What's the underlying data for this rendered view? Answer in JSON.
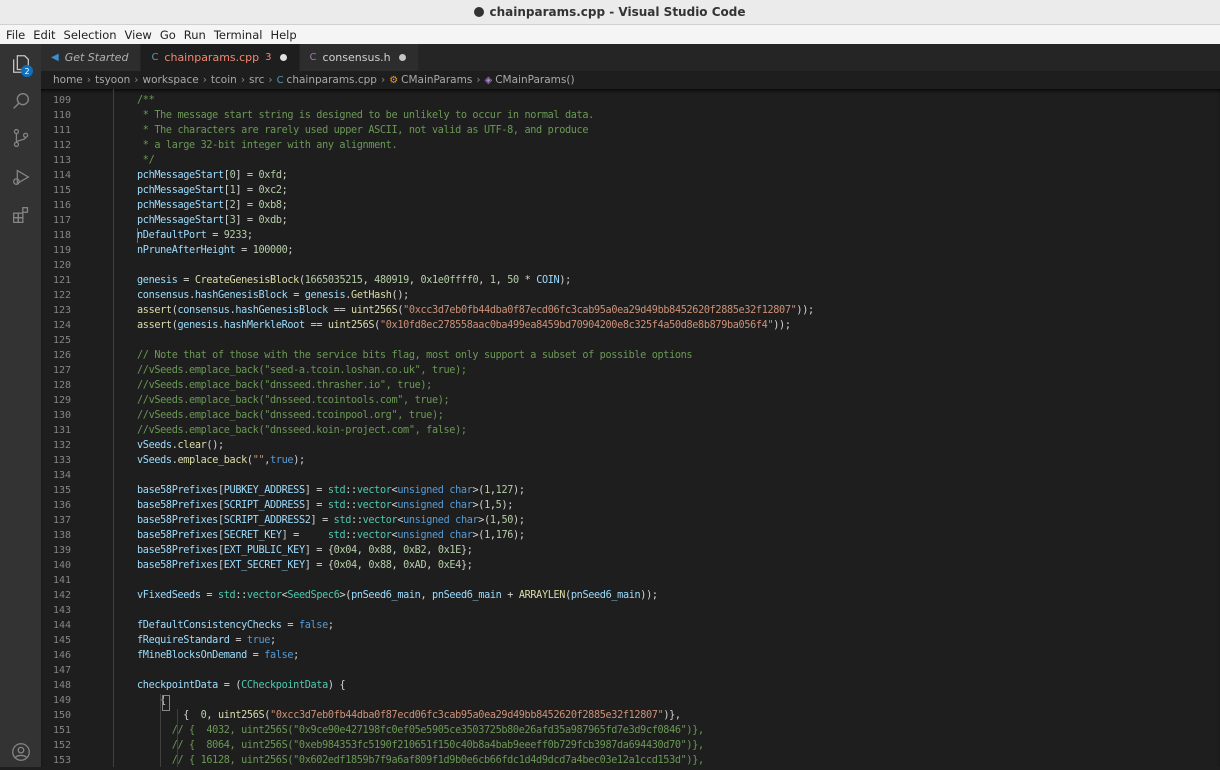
{
  "window": {
    "title": "chainparams.cpp - Visual Studio Code"
  },
  "menu": [
    "File",
    "Edit",
    "Selection",
    "View",
    "Go",
    "Run",
    "Terminal",
    "Help"
  ],
  "activity": {
    "explorer_badge": "2"
  },
  "tabs": [
    {
      "icon": "◀",
      "label": "Get Started",
      "count": "",
      "modified": false
    },
    {
      "icon": "C",
      "label": "chainparams.cpp",
      "count": "3",
      "modified": true
    },
    {
      "icon": "C",
      "label": "consensus.h",
      "count": "",
      "modified": true
    }
  ],
  "breadcrumb": [
    "home",
    "tsyoon",
    "workspace",
    "tcoin",
    "src",
    "chainparams.cpp",
    "CMainParams",
    "CMainParams()"
  ],
  "editor": {
    "line_numbers": [
      "108",
      "109",
      "110",
      "111",
      "112",
      "113",
      "114",
      "115",
      "116",
      "117",
      "118",
      "119",
      "120",
      "121",
      "122",
      "123",
      "124",
      "125",
      "126",
      "127",
      "128",
      "129",
      "130",
      "131",
      "132",
      "133",
      "134",
      "135",
      "136",
      "137",
      "138",
      "139",
      "140",
      "141",
      "142",
      "143",
      "144",
      "145",
      "146",
      "147",
      "148",
      "149",
      "150",
      "151",
      "152",
      "153"
    ],
    "lines": [
      [],
      [
        [
          "cmt",
          "/**"
        ]
      ],
      [
        [
          "cmt",
          " * The message start string is designed to be unlikely to occur in normal data."
        ]
      ],
      [
        [
          "cmt",
          " * The characters are rarely used upper ASCII, not valid as UTF-8, and produce"
        ]
      ],
      [
        [
          "cmt",
          " * a large 32-bit integer with any alignment."
        ]
      ],
      [
        [
          "cmt",
          " */"
        ]
      ],
      [
        [
          "var",
          "pchMessageStart"
        ],
        [
          "",
          "["
        ],
        [
          "num",
          "0"
        ],
        [
          "",
          "] = "
        ],
        [
          "num",
          "0xfd"
        ],
        [
          "",
          ";"
        ]
      ],
      [
        [
          "var",
          "pchMessageStart"
        ],
        [
          "",
          "["
        ],
        [
          "num",
          "1"
        ],
        [
          "",
          "] = "
        ],
        [
          "num",
          "0xc2"
        ],
        [
          "",
          ";"
        ]
      ],
      [
        [
          "var",
          "pchMessageStart"
        ],
        [
          "",
          "["
        ],
        [
          "num",
          "2"
        ],
        [
          "",
          "] = "
        ],
        [
          "num",
          "0xb8"
        ],
        [
          "",
          ";"
        ]
      ],
      [
        [
          "var",
          "pchMessageStart"
        ],
        [
          "",
          "["
        ],
        [
          "num",
          "3"
        ],
        [
          "",
          "] = "
        ],
        [
          "num",
          "0xdb"
        ],
        [
          "",
          ";"
        ]
      ],
      [
        [
          "var",
          "nDefaultPort"
        ],
        [
          "",
          " = "
        ],
        [
          "num",
          "9233"
        ],
        [
          "",
          ";"
        ]
      ],
      [
        [
          "var",
          "nPruneAfterHeight"
        ],
        [
          "",
          " = "
        ],
        [
          "num",
          "100000"
        ],
        [
          "",
          ";"
        ]
      ],
      [],
      [
        [
          "var",
          "genesis"
        ],
        [
          "",
          " = "
        ],
        [
          "fn",
          "CreateGenesisBlock"
        ],
        [
          "",
          "("
        ],
        [
          "num",
          "1665035215"
        ],
        [
          "",
          ", "
        ],
        [
          "num",
          "480919"
        ],
        [
          "",
          ", "
        ],
        [
          "num",
          "0x1e0ffff0"
        ],
        [
          "",
          ", "
        ],
        [
          "num",
          "1"
        ],
        [
          "",
          ", "
        ],
        [
          "num",
          "50"
        ],
        [
          "",
          " * "
        ],
        [
          "var",
          "COIN"
        ],
        [
          "",
          ");"
        ]
      ],
      [
        [
          "var",
          "consensus"
        ],
        [
          "",
          "."
        ],
        [
          "var",
          "hashGenesisBlock"
        ],
        [
          "",
          " = "
        ],
        [
          "var",
          "genesis"
        ],
        [
          "",
          "."
        ],
        [
          "fn",
          "GetHash"
        ],
        [
          "",
          "();"
        ]
      ],
      [
        [
          "fn",
          "assert"
        ],
        [
          "",
          "("
        ],
        [
          "var",
          "consensus"
        ],
        [
          "",
          "."
        ],
        [
          "var",
          "hashGenesisBlock"
        ],
        [
          "",
          " == "
        ],
        [
          "fn",
          "uint256S"
        ],
        [
          "",
          "("
        ],
        [
          "str",
          "\"0xcc3d7eb0fb44dba0f87ecd06fc3cab95a0ea29d49bb8452620f2885e32f12807\""
        ],
        [
          "",
          "));"
        ]
      ],
      [
        [
          "fn",
          "assert"
        ],
        [
          "",
          "("
        ],
        [
          "var",
          "genesis"
        ],
        [
          "",
          "."
        ],
        [
          "var",
          "hashMerkleRoot"
        ],
        [
          "",
          " == "
        ],
        [
          "fn",
          "uint256S"
        ],
        [
          "",
          "("
        ],
        [
          "str",
          "\"0x10fd8ec278558aac0ba499ea8459bd70904200e8c325f4a50d8e8b879ba056f4\""
        ],
        [
          "",
          "));"
        ]
      ],
      [],
      [
        [
          "cmt",
          "// Note that of those with the service bits flag, most only support a subset of possible options"
        ]
      ],
      [
        [
          "cmt",
          "//vSeeds.emplace_back(\"seed-a.tcoin.loshan.co.uk\", true);"
        ]
      ],
      [
        [
          "cmt",
          "//vSeeds.emplace_back(\"dnsseed.thrasher.io\", true);"
        ]
      ],
      [
        [
          "cmt",
          "//vSeeds.emplace_back(\"dnsseed.tcointools.com\", true);"
        ]
      ],
      [
        [
          "cmt",
          "//vSeeds.emplace_back(\"dnsseed.tcoinpool.org\", true);"
        ]
      ],
      [
        [
          "cmt",
          "//vSeeds.emplace_back(\"dnsseed.koin-project.com\", false);"
        ]
      ],
      [
        [
          "var",
          "vSeeds"
        ],
        [
          "",
          "."
        ],
        [
          "fn",
          "clear"
        ],
        [
          "",
          "();"
        ]
      ],
      [
        [
          "var",
          "vSeeds"
        ],
        [
          "",
          "."
        ],
        [
          "fn",
          "emplace_back"
        ],
        [
          "",
          "("
        ],
        [
          "str",
          "\"\""
        ],
        [
          "",
          ","
        ],
        [
          "kw",
          "true"
        ],
        [
          "",
          ");"
        ]
      ],
      [],
      [
        [
          "var",
          "base58Prefixes"
        ],
        [
          "",
          "["
        ],
        [
          "var",
          "PUBKEY_ADDRESS"
        ],
        [
          "",
          "] = "
        ],
        [
          "ty",
          "std"
        ],
        [
          "",
          "::"
        ],
        [
          "ty",
          "vector"
        ],
        [
          "",
          "<"
        ],
        [
          "kw",
          "unsigned char"
        ],
        [
          "",
          ">("
        ],
        [
          "num",
          "1"
        ],
        [
          "",
          ","
        ],
        [
          "num",
          "127"
        ],
        [
          "",
          ");"
        ]
      ],
      [
        [
          "var",
          "base58Prefixes"
        ],
        [
          "",
          "["
        ],
        [
          "var",
          "SCRIPT_ADDRESS"
        ],
        [
          "",
          "] = "
        ],
        [
          "ty",
          "std"
        ],
        [
          "",
          "::"
        ],
        [
          "ty",
          "vector"
        ],
        [
          "",
          "<"
        ],
        [
          "kw",
          "unsigned char"
        ],
        [
          "",
          ">("
        ],
        [
          "num",
          "1"
        ],
        [
          "",
          ","
        ],
        [
          "num",
          "5"
        ],
        [
          "",
          ");"
        ]
      ],
      [
        [
          "var",
          "base58Prefixes"
        ],
        [
          "",
          "["
        ],
        [
          "var",
          "SCRIPT_ADDRESS2"
        ],
        [
          "",
          "] = "
        ],
        [
          "ty",
          "std"
        ],
        [
          "",
          "::"
        ],
        [
          "ty",
          "vector"
        ],
        [
          "",
          "<"
        ],
        [
          "kw",
          "unsigned char"
        ],
        [
          "",
          ">("
        ],
        [
          "num",
          "1"
        ],
        [
          "",
          ","
        ],
        [
          "num",
          "50"
        ],
        [
          "",
          ");"
        ]
      ],
      [
        [
          "var",
          "base58Prefixes"
        ],
        [
          "",
          "["
        ],
        [
          "var",
          "SECRET_KEY"
        ],
        [
          "",
          "] =     "
        ],
        [
          "ty",
          "std"
        ],
        [
          "",
          "::"
        ],
        [
          "ty",
          "vector"
        ],
        [
          "",
          "<"
        ],
        [
          "kw",
          "unsigned char"
        ],
        [
          "",
          ">("
        ],
        [
          "num",
          "1"
        ],
        [
          "",
          ","
        ],
        [
          "num",
          "176"
        ],
        [
          "",
          ");"
        ]
      ],
      [
        [
          "var",
          "base58Prefixes"
        ],
        [
          "",
          "["
        ],
        [
          "var",
          "EXT_PUBLIC_KEY"
        ],
        [
          "",
          "] = {"
        ],
        [
          "num",
          "0x04"
        ],
        [
          "",
          ", "
        ],
        [
          "num",
          "0x88"
        ],
        [
          "",
          ", "
        ],
        [
          "num",
          "0xB2"
        ],
        [
          "",
          ", "
        ],
        [
          "num",
          "0x1E"
        ],
        [
          "",
          "};"
        ]
      ],
      [
        [
          "var",
          "base58Prefixes"
        ],
        [
          "",
          "["
        ],
        [
          "var",
          "EXT_SECRET_KEY"
        ],
        [
          "",
          "] = {"
        ],
        [
          "num",
          "0x04"
        ],
        [
          "",
          ", "
        ],
        [
          "num",
          "0x88"
        ],
        [
          "",
          ", "
        ],
        [
          "num",
          "0xAD"
        ],
        [
          "",
          ", "
        ],
        [
          "num",
          "0xE4"
        ],
        [
          "",
          "};"
        ]
      ],
      [],
      [
        [
          "var",
          "vFixedSeeds"
        ],
        [
          "",
          " = "
        ],
        [
          "ty",
          "std"
        ],
        [
          "",
          "::"
        ],
        [
          "ty",
          "vector"
        ],
        [
          "",
          "<"
        ],
        [
          "ty",
          "SeedSpec6"
        ],
        [
          "",
          ">("
        ],
        [
          "var",
          "pnSeed6_main"
        ],
        [
          "",
          ", "
        ],
        [
          "var",
          "pnSeed6_main"
        ],
        [
          "",
          " + "
        ],
        [
          "fn",
          "ARRAYLEN"
        ],
        [
          "",
          "("
        ],
        [
          "var",
          "pnSeed6_main"
        ],
        [
          "",
          "));"
        ]
      ],
      [],
      [
        [
          "var",
          "fDefaultConsistencyChecks"
        ],
        [
          "",
          " = "
        ],
        [
          "kw",
          "false"
        ],
        [
          "",
          ";"
        ]
      ],
      [
        [
          "var",
          "fRequireStandard"
        ],
        [
          "",
          " = "
        ],
        [
          "kw",
          "true"
        ],
        [
          "",
          ";"
        ]
      ],
      [
        [
          "var",
          "fMineBlocksOnDemand"
        ],
        [
          "",
          " = "
        ],
        [
          "kw",
          "false"
        ],
        [
          "",
          ";"
        ]
      ],
      [],
      [
        [
          "var",
          "checkpointData"
        ],
        [
          "",
          " = ("
        ],
        [
          "ty",
          "CCheckpointData"
        ],
        [
          "",
          ") {"
        ]
      ],
      [
        [
          "",
          "    {"
        ]
      ],
      [
        [
          "",
          "        {  "
        ],
        [
          "num",
          "0"
        ],
        [
          "",
          ", "
        ],
        [
          "fn",
          "uint256S"
        ],
        [
          "",
          "("
        ],
        [
          "str",
          "\"0xcc3d7eb0fb44dba0f87ecd06fc3cab95a0ea29d49bb8452620f2885e32f12807\""
        ],
        [
          "",
          ")},"
        ]
      ],
      [
        [
          "cmt",
          "      // {  4032, uint256S(\"0x9ce90e427198fc0ef05e5905ce3503725b80e26afd35a987965fd7e3d9cf0846\")},"
        ]
      ],
      [
        [
          "cmt",
          "      // {  8064, uint256S(\"0xeb984353fc5190f210651f150c40b8a4bab9eeeff0b729fcb3987da694430d70\")},"
        ]
      ],
      [
        [
          "cmt",
          "      // { 16128, uint256S(\"0x602edf1859b7f9a6af809f1d9b0e6cb66fdc1d4d9dcd7a4bec03e12a1ccd153d\")},"
        ]
      ]
    ]
  }
}
